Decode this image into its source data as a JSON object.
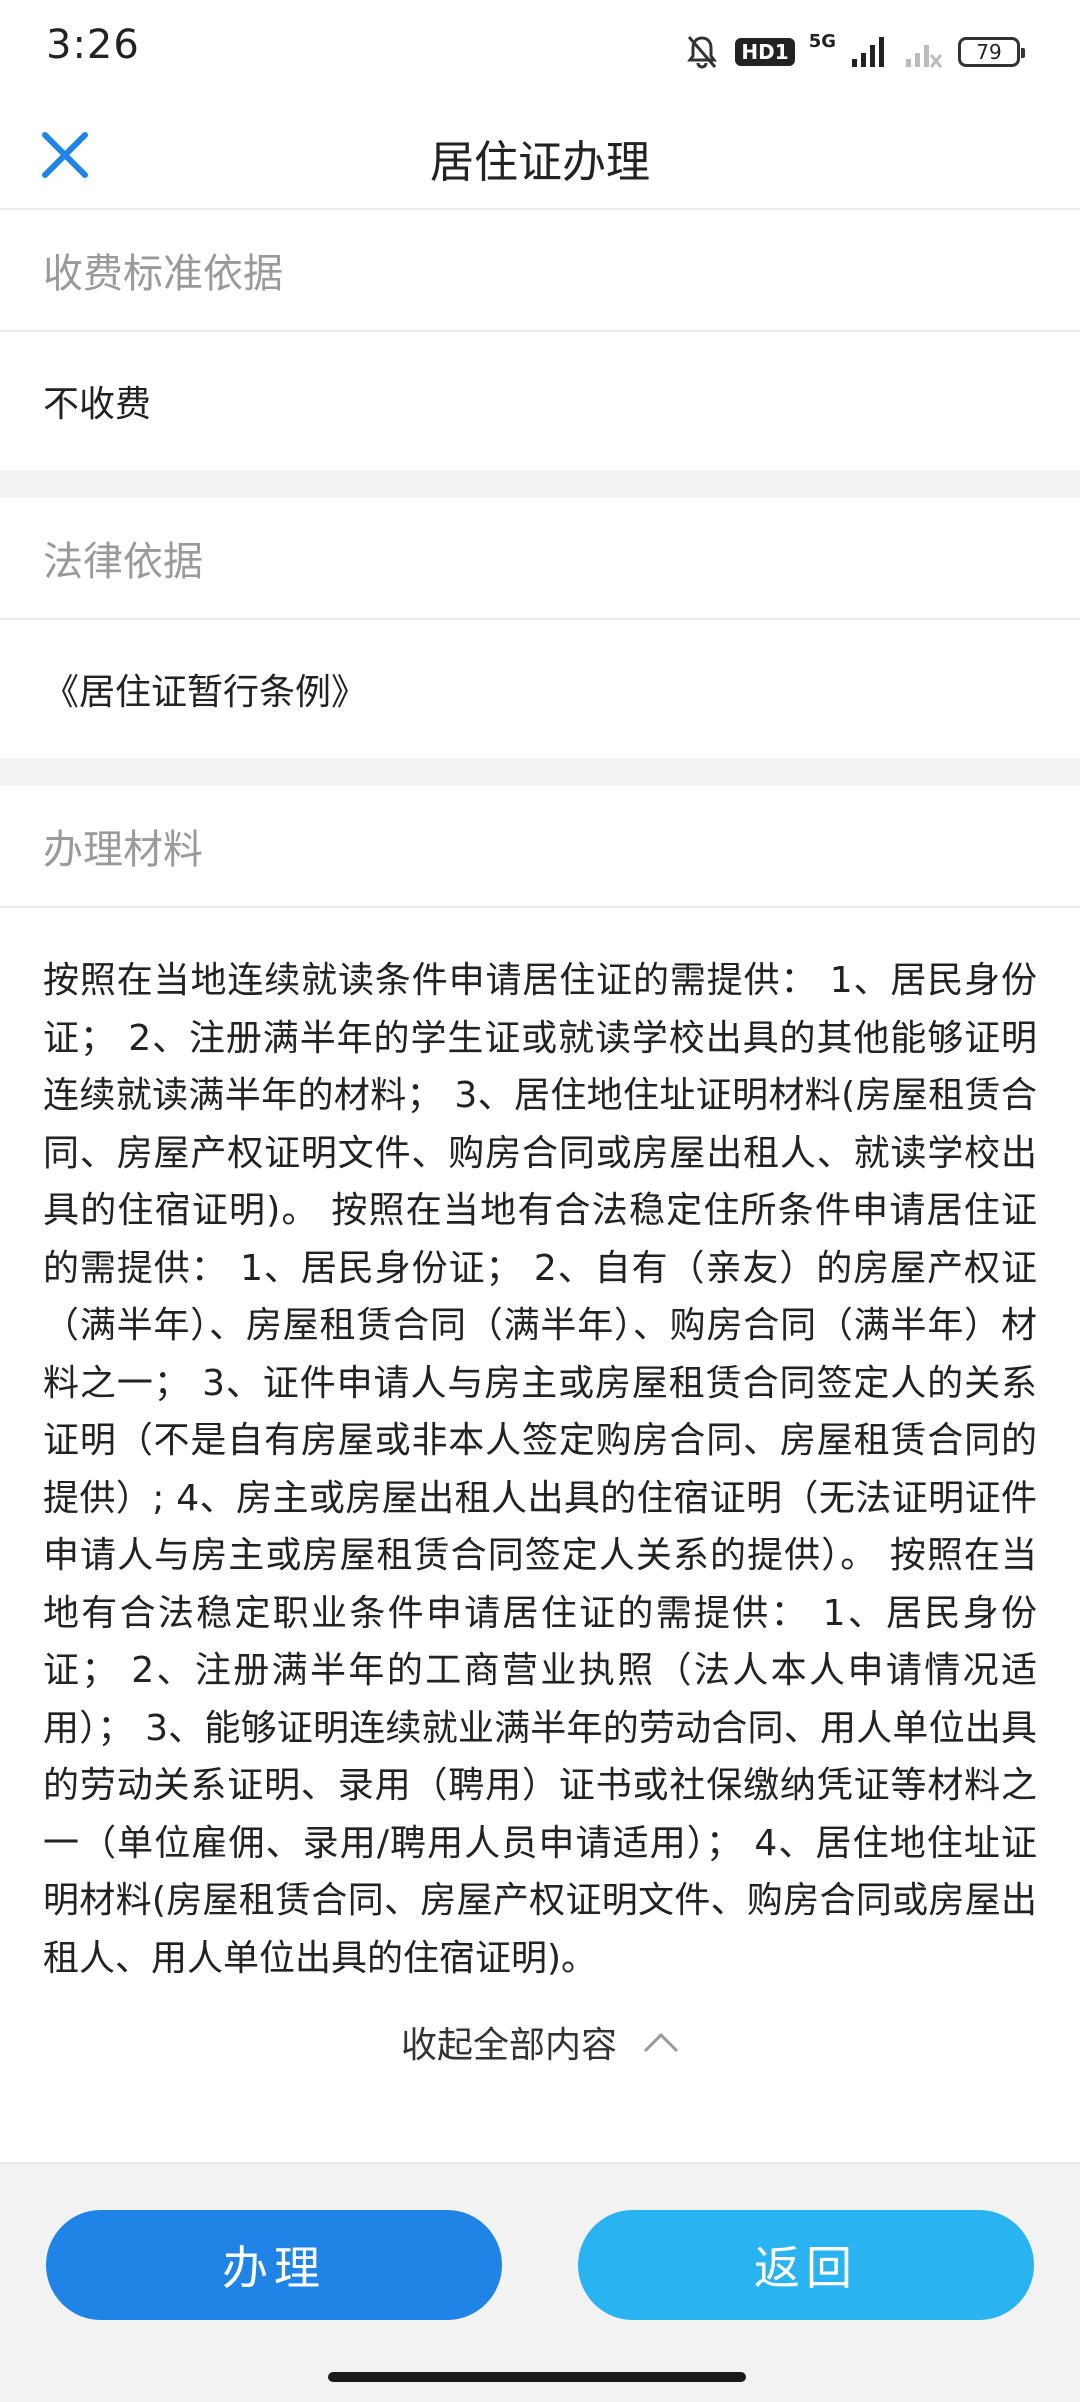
{
  "status_bar": {
    "time": "3:26",
    "hd_badge": "HD1",
    "network": "5G",
    "battery": "79",
    "icons": [
      "bell-mute-icon",
      "signal-icon",
      "signal-weak-icon",
      "battery-icon"
    ]
  },
  "header": {
    "title": "居住证办理",
    "close_icon": "close-icon"
  },
  "sections": {
    "fee": {
      "title": "收费标准依据",
      "body": "不收费"
    },
    "legal": {
      "title": "法律依据",
      "body": "《居住证暂行条例》"
    },
    "materials": {
      "title": "办理材料",
      "body": "按照在当地连续就读条件申请居住证的需提供： 1、居民身份证； 2、注册满半年的学生证或就读学校出具的其他能够证明连续就读满半年的材料； 3、居住地住址证明材料(房屋租赁合同、房屋产权证明文件、购房合同或房屋出租人、就读学校出具的住宿证明)。 按照在当地有合法稳定住所条件申请居住证的需提供： 1、居民身份证； 2、自有（亲友）的房屋产权证（满半年）、房屋租赁合同（满半年）、购房合同（满半年）材料之一； 3、证件申请人与房主或房屋租赁合同签定人的关系证明（不是自有房屋或非本人签定购房合同、房屋租赁合同的提供）; 4、房主或房屋出租人出具的住宿证明（无法证明证件申请人与房主或房屋租赁合同签定人关系的提供）。 按照在当地有合法稳定职业条件申请居住证的需提供： 1、居民身份证； 2、注册满半年的工商营业执照（法人本人申请情况适用）； 3、能够证明连续就业满半年的劳动合同、用人单位出具的劳动关系证明、录用（聘用）证书或社保缴纳凭证等材料之一（单位雇佣、录用/聘用人员申请适用）； 4、居住地住址证明材料(房屋租赁合同、房屋产权证明文件、购房合同或房屋出租人、用人单位出具的住宿证明)。",
      "collapse_label": "收起全部内容"
    }
  },
  "actions": {
    "apply_label": "办理",
    "back_label": "返回"
  },
  "colors": {
    "apply_button": "#1f84e6",
    "back_button": "#2ab3f1",
    "close_icon": "#1f84e6",
    "section_title": "#9a9a9a"
  }
}
